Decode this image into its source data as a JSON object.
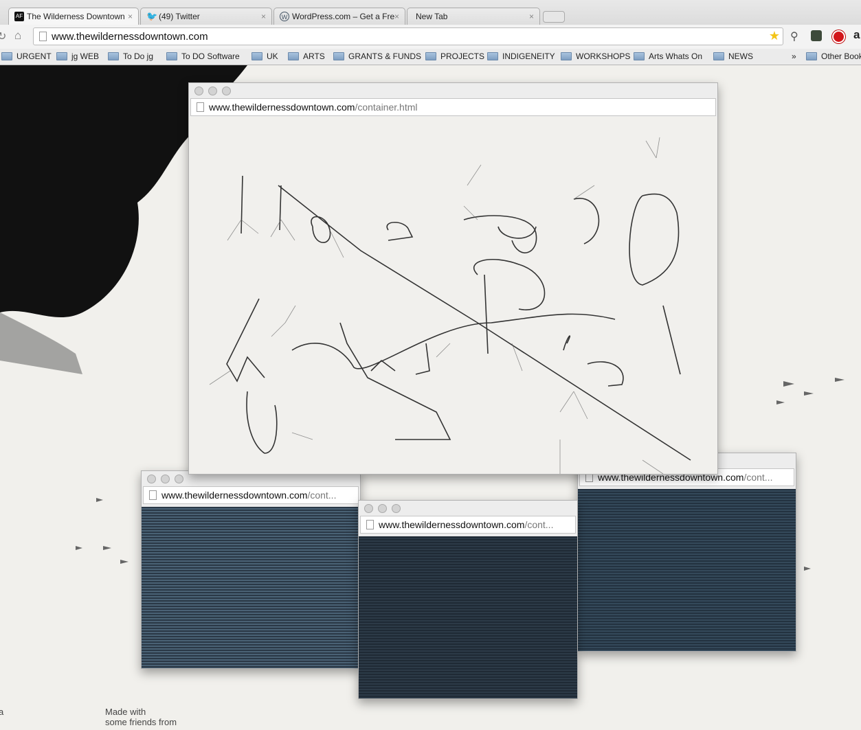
{
  "tabs": [
    {
      "label": "The Wilderness Downtown",
      "icon": "AF",
      "active": true
    },
    {
      "label": "(49) Twitter",
      "icon": "twitter-icon"
    },
    {
      "label": "WordPress.com – Get a Fre",
      "icon": "wordpress-icon"
    },
    {
      "label": "New Tab"
    }
  ],
  "tab_close": "×",
  "address": "www.thewildernessdowntown.com",
  "bookmarks": [
    "URGENT",
    "jg WEB",
    "To Do jg",
    "To DO Software",
    "UK",
    "ARTS",
    "GRANTS & FUNDS",
    "PROJECTS",
    "INDIGENEITY",
    "WORKSHOPS",
    "Arts Whats On",
    "NEWS"
  ],
  "bookmarks_overflow": "»",
  "other_bookmarks": "Other Book",
  "popups": {
    "main": {
      "domain": "www.thewildernessdowntown.com",
      "path": "/container.html"
    },
    "left": {
      "domain": "www.thewildernessdowntown.com",
      "path": "/cont..."
    },
    "middle": {
      "domain": "www.thewildernessdowntown.com",
      "path": "/cont..."
    },
    "right": {
      "domain": "www.thewildernessdowntown.com",
      "path": "/cont..."
    }
  },
  "footer": {
    "made_with": "Made with",
    "friends": "some friends from",
    "left_char": "a"
  }
}
